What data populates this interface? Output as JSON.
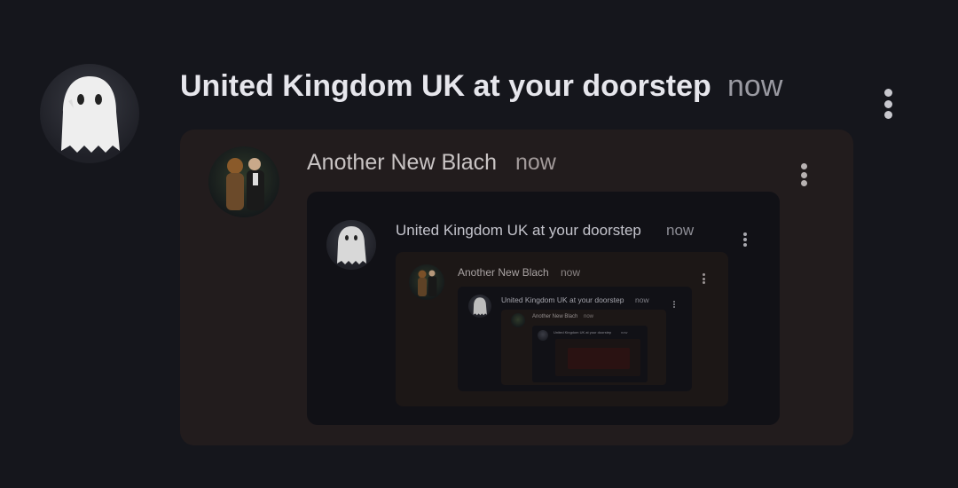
{
  "post": {
    "author": "United Kingdom UK at your doorstep",
    "time": "now",
    "avatar_icon": "ghost-avatar-icon",
    "menu_icon": "more-vertical-icon"
  },
  "quote1": {
    "author": "Another New Blach",
    "time": "now",
    "avatar_icon": "couple-avatar-icon"
  },
  "quote2": {
    "author": "United Kingdom UK at your doorstep",
    "time": "now"
  },
  "quote3": {
    "author": "Another New Blach",
    "time": "now"
  },
  "quote4": {
    "author": "United Kingdom UK at your doorstep",
    "time": "now"
  },
  "quote5": {
    "author": "Another New Blach",
    "time": "now"
  },
  "quote6": {
    "author": "United Kingdom UK at your doorstep",
    "time": "now"
  },
  "colors": {
    "background": "#15161c",
    "quote_brown": "#221c1d",
    "quote_dark": "#111116"
  }
}
